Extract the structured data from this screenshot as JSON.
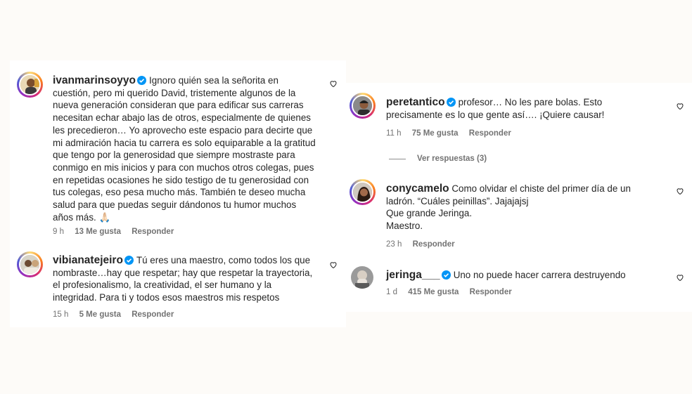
{
  "colors": {
    "verified": "#0095f6",
    "text": "#262626",
    "meta": "#737373"
  },
  "left_comments": [
    {
      "username": "ivanmarinsoyyo",
      "lines": [
        "Ignoro quién sea la señorita en",
        "cuestión, pero mi querido David, tristemente algunos de la",
        "nueva generación consideran que para edificar sus carreras",
        "necesitan echar abajo las de otros, especialmente de quienes",
        "les precedieron… Yo aprovecho este espacio para decirte que",
        "mi admiración hacia tu carrera es solo equiparable a la gratitud",
        "que tengo por la generosidad que siempre mostraste para",
        "conmigo en mis inicios y para con muchos otros colegas, pues",
        "en repetidas ocasiones he sido testigo de tu generosidad con",
        "tus colegas, eso pesa mucho más. También te deseo mucha",
        "salud para que puedas seguir dándonos tu humor muchos",
        "años más. 🙏🏻"
      ],
      "time": "9 h",
      "likes": "13 Me gusta",
      "reply": "Responder"
    },
    {
      "username": "vibianatejeiro",
      "lines": [
        "Tú eres una maestro, como todos los que",
        "nombraste…hay que respetar; hay que respetar la trayectoria,",
        "el profesionalismo, la creatividad, el ser humano y la",
        "integridad. Para ti y todos esos maestros mis respetos"
      ],
      "time": "15 h",
      "likes": "5 Me gusta",
      "reply": "Responder"
    }
  ],
  "right_comments": [
    {
      "username": "peretantico",
      "lines": [
        "profesor… No les pare bolas. Esto",
        "precisamente es lo que gente así…. ¡Quiere causar!"
      ],
      "time": "11 h",
      "likes": "75 Me gusta",
      "reply": "Responder",
      "view_replies": "Ver respuestas (3)"
    },
    {
      "username": "conycamelo",
      "lines": [
        "Como olvidar el chiste del primer día de un",
        "ladrón. “Cuáles peinillas”. Jajajajsj",
        "Que grande Jeringa.",
        "Maestro."
      ],
      "time": "23 h",
      "reply": "Responder"
    },
    {
      "username": "jeringa___",
      "lines": [
        "Uno no puede hacer carrera destruyendo"
      ],
      "time": "1 d",
      "likes": "415 Me gusta",
      "reply": "Responder"
    }
  ]
}
